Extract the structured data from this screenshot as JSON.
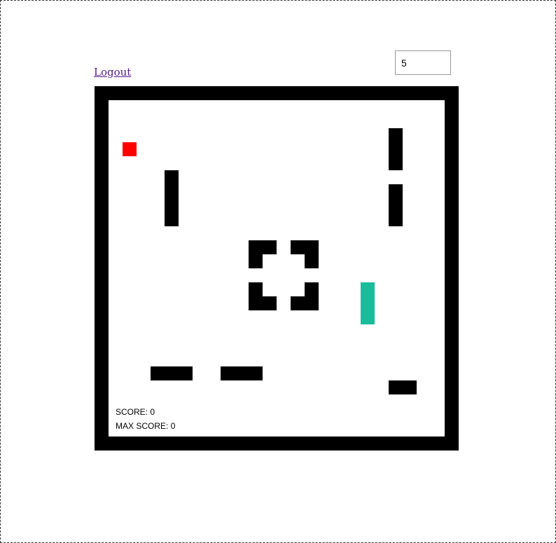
{
  "header": {
    "logout_label": "Logout",
    "speed_value": "5"
  },
  "game": {
    "score_label": "SCORE:",
    "score": "0",
    "max_score_label": "MAX SCORE:",
    "max_score": "0",
    "colors": {
      "border": "#000000",
      "wall": "#000000",
      "food": "#ff0000",
      "snake": "#1abc9c",
      "background": "#ffffff"
    }
  }
}
